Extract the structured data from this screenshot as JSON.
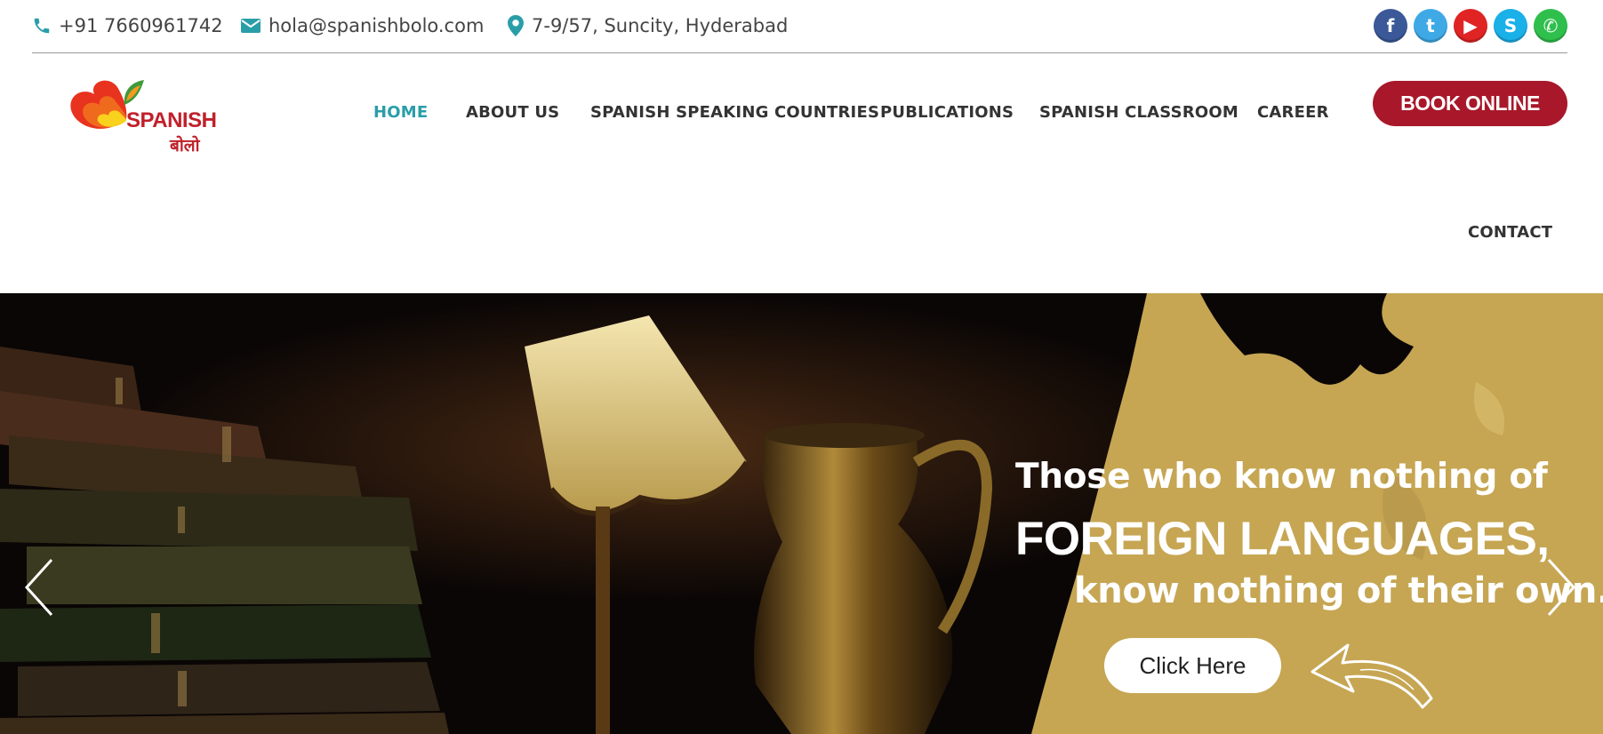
{
  "topbar": {
    "phone": "+91 7660961742",
    "email": "hola@spanishbolo.com",
    "address": "7-9/57, Suncity, Hyderabad",
    "social": [
      {
        "name": "facebook",
        "glyph": "f",
        "color": "#3b5998"
      },
      {
        "name": "twitter",
        "glyph": "t",
        "color": "#3fa9e6"
      },
      {
        "name": "youtube",
        "glyph": "▶",
        "color": "#e02424"
      },
      {
        "name": "skype",
        "glyph": "S",
        "color": "#1ab0e8"
      },
      {
        "name": "whatsapp",
        "glyph": "✆",
        "color": "#2fbf4c"
      }
    ]
  },
  "logo": {
    "text": "SPANISH",
    "subtext": "बोलो"
  },
  "nav": {
    "items": [
      {
        "label": "HOME",
        "active": true
      },
      {
        "label": "ABOUT US",
        "active": false
      },
      {
        "label": "SPANISH SPEAKING COUNTRIES",
        "active": false
      },
      {
        "label": "PUBLICATIONS",
        "active": false
      },
      {
        "label": "SPANISH CLASSROOM",
        "active": false
      },
      {
        "label": "CAREER",
        "active": false
      },
      {
        "label": "CONTACT",
        "active": false
      }
    ],
    "book_button": "BOOK ONLINE"
  },
  "hero": {
    "line1": "Those who know nothing of",
    "line2": "FOREIGN LANGUAGES,",
    "line3": "know nothing of their own.",
    "cta": "Click Here"
  },
  "colors": {
    "accent": "#2a9ea8",
    "brand_red": "#a8182a",
    "hero_gold": "#c6a653"
  }
}
